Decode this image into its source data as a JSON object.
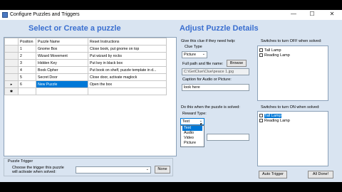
{
  "window": {
    "title": "Configure Puzzles and Triggers",
    "minimize": "—",
    "maximize": "☐",
    "close": "✕"
  },
  "left": {
    "heading": "Select or Create a puzzle",
    "columns": [
      "Position",
      "Puzzle Name",
      "Reset Instructions"
    ],
    "rows": [
      {
        "pos": "1",
        "name": "Gnome Box",
        "reset": "Close book, put gnome on top"
      },
      {
        "pos": "2",
        "name": "Wizard Movement",
        "reset": "Put wizard by rocks"
      },
      {
        "pos": "3",
        "name": "Hidden Key",
        "reset": "Put key in black box"
      },
      {
        "pos": "4",
        "name": "Book Cipher",
        "reset": "Put book on shelf, puzzle template in d..."
      },
      {
        "pos": "5",
        "name": "Secret Door",
        "reset": "Close door, activate maglock"
      },
      {
        "pos": "6",
        "name": "New Puzzle",
        "reset": "Open the box"
      }
    ],
    "row_markers": [
      "",
      "",
      "",
      "",
      "",
      "▸",
      "✱"
    ],
    "trigger_label": "Puzzle Trigger",
    "trigger_desc": "Choose the trigger this puzzle will activate when solved:",
    "trigger_value": "",
    "none_button": "None"
  },
  "right": {
    "heading": "Adjust Puzzle Details",
    "give_clue": "Give this clue if they need help:",
    "clue_type_label": "Clue Type",
    "clue_type_value": "Picture",
    "path_label": "Full path and file name:",
    "path_value": "C:\\GetClue\\Clue\\peace 1.jpg",
    "browse": "Browse",
    "caption_label": "Caption for Audio or Picture:",
    "caption_value": "look here",
    "when_solved": "Do this when the puzzle is solved:",
    "reward_label": "Reward Type:",
    "reward_value": "Text",
    "reward_options": [
      "Text",
      "Audio",
      "Video",
      "Picture"
    ],
    "switch_off_label": "Switches to turn OFF when solved:",
    "switch_off": [
      "Tall Lamp",
      "Reading Lamp"
    ],
    "switch_on_label": "Switches to turn ON when solved:",
    "switch_on": [
      "Tall Lamp",
      "Reading Lamp"
    ],
    "auto_trigger": "Auto Trigger",
    "all_done": "All Done!"
  },
  "colors": {
    "accent": "#3a6fd0",
    "selection": "#0078d7",
    "background": "#d9e4f1"
  }
}
